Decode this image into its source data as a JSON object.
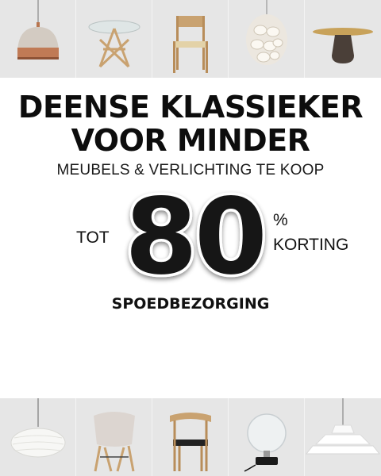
{
  "banner": {
    "headline_line1": "DEENSE KLASSIEKER",
    "headline_line2": "VOOR MINDER",
    "subheadline": "MEUBELS & VERLICHTING TE KOOP",
    "discount_prefix": "TOT",
    "discount_value": "80",
    "discount_unit": "%",
    "discount_suffix": "KORTING",
    "delivery": "SPOEDBEZORGING"
  },
  "top_products": [
    {
      "icon": "copper-pendant-lamp-icon"
    },
    {
      "icon": "glass-star-table-icon"
    },
    {
      "icon": "wooden-chair-icon"
    },
    {
      "icon": "shell-chandelier-icon"
    },
    {
      "icon": "bronze-side-table-icon"
    }
  ],
  "bottom_products": [
    {
      "icon": "bubble-pendant-lamp-icon"
    },
    {
      "icon": "eames-armchair-icon"
    },
    {
      "icon": "wooden-armchair-icon"
    },
    {
      "icon": "globe-table-lamp-icon"
    },
    {
      "icon": "ph-pendant-lamp-icon"
    }
  ],
  "colors": {
    "tile_background": "#e6e6e6",
    "text": "#111111",
    "copper": "#c07a55",
    "wood": "#c9a270"
  }
}
